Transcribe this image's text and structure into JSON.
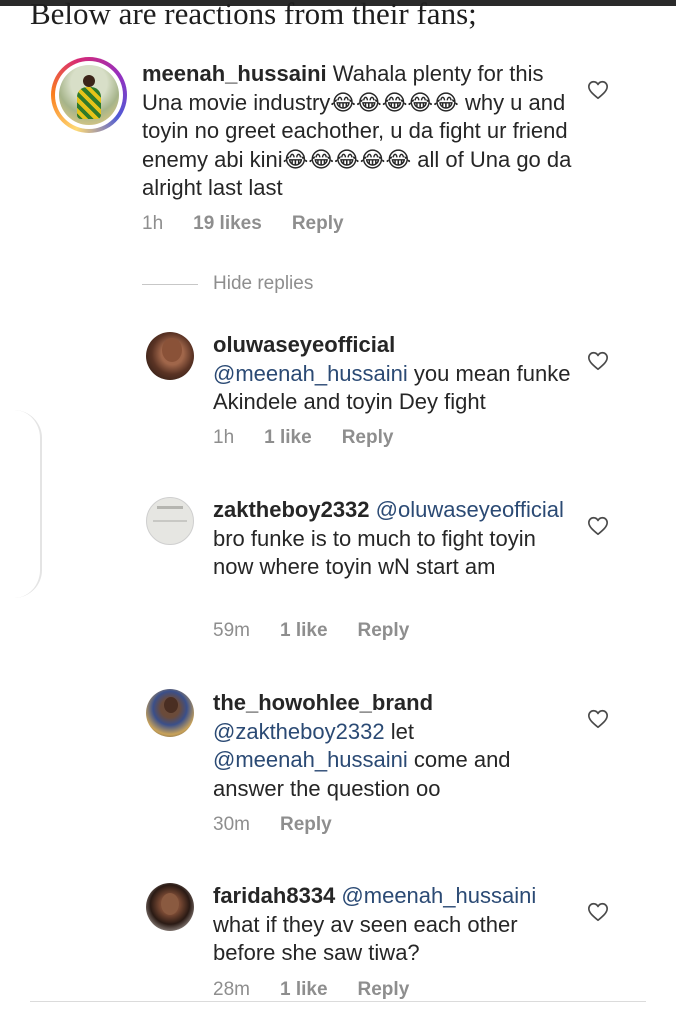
{
  "heading": "Below are reactions from their fans;",
  "hide_replies": "Hide replies",
  "comments": [
    {
      "username": "meenah_hussaini",
      "text": "Wahala plenty for this Una movie industry😂😂😂😂😂 why u and toyin no greet eachother, u da fight ur friend enemy abi kini😂😂😂😂😂 all of Una go da alright last last",
      "time": "1h",
      "likes": "19 likes",
      "reply": "Reply"
    },
    {
      "username": "oluwaseyeofficial",
      "mention": "@meenah_hussaini",
      "text": "you mean funke Akindele and toyin Dey fight",
      "time": "1h",
      "likes": "1 like",
      "reply": "Reply"
    },
    {
      "username": "zaktheboy2332",
      "mention": "@oluwaseyeofficial",
      "text": "bro funke is to much to fight toyin now where toyin wN start am",
      "time": "59m",
      "likes": "1 like",
      "reply": "Reply"
    },
    {
      "username": "the_howohlee_brand",
      "mention": "@zaktheboy2332",
      "text_a": "let",
      "mention_b": "@meenah_hussaini",
      "text_b": "come and answer the question oo",
      "time": "30m",
      "reply": "Reply"
    },
    {
      "username": "faridah8334",
      "mention": "@meenah_hussaini",
      "text": "what if they av seen each other before she saw tiwa?",
      "time": "28m",
      "likes": "1 like",
      "reply": "Reply"
    }
  ]
}
